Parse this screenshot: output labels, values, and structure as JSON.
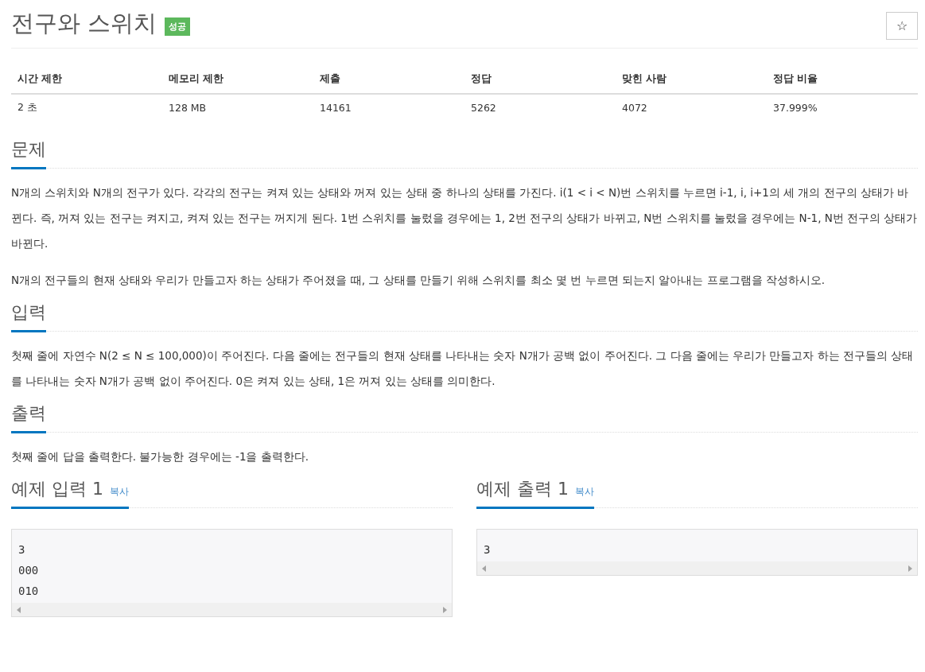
{
  "title": "전구와 스위치",
  "badge": "성공",
  "star_button": "☆",
  "stats": {
    "columns": [
      "시간 제한",
      "메모리 제한",
      "제출",
      "정답",
      "맞힌 사람",
      "정답 비율"
    ],
    "rows": [
      [
        "2 초",
        "128 MB",
        "14161",
        "5262",
        "4072",
        "37.999%"
      ]
    ]
  },
  "sections": [
    {
      "heading": "문제",
      "paragraphs": [
        "N개의 스위치와 N개의 전구가 있다. 각각의 전구는 켜져 있는 상태와 꺼져 있는 상태 중 하나의 상태를 가진다. i(1 < i < N)번 스위치를 누르면 i-1, i, i+1의 세 개의 전구의 상태가 바뀐다. 즉, 꺼져 있는 전구는 켜지고, 켜져 있는 전구는 꺼지게 된다. 1번 스위치를 눌렀을 경우에는 1, 2번 전구의 상태가 바뀌고, N번 스위치를 눌렀을 경우에는 N-1, N번 전구의 상태가 바뀐다.",
        "N개의 전구들의 현재 상태와 우리가 만들고자 하는 상태가 주어졌을 때, 그 상태를 만들기 위해 스위치를 최소 몇 번 누르면 되는지 알아내는 프로그램을 작성하시오."
      ]
    },
    {
      "heading": "입력",
      "paragraphs": [
        "첫째 줄에 자연수 N(2 ≤ N ≤ 100,000)이 주어진다. 다음 줄에는 전구들의 현재 상태를 나타내는 숫자 N개가 공백 없이 주어진다. 그 다음 줄에는 우리가 만들고자 하는 전구들의 상태를 나타내는 숫자 N개가 공백 없이 주어진다. 0은 켜져 있는 상태, 1은 꺼져 있는 상태를 의미한다."
      ]
    },
    {
      "heading": "출력",
      "paragraphs": [
        "첫째 줄에 답을 출력한다. 불가능한 경우에는 -1을 출력한다."
      ]
    }
  ],
  "samples": [
    {
      "heading": "예제 입력 1",
      "copy_label": "복사",
      "lines": [
        "3",
        "000",
        "010"
      ]
    },
    {
      "heading": "예제 출력 1",
      "copy_label": "복사",
      "lines": [
        "3"
      ]
    }
  ]
}
